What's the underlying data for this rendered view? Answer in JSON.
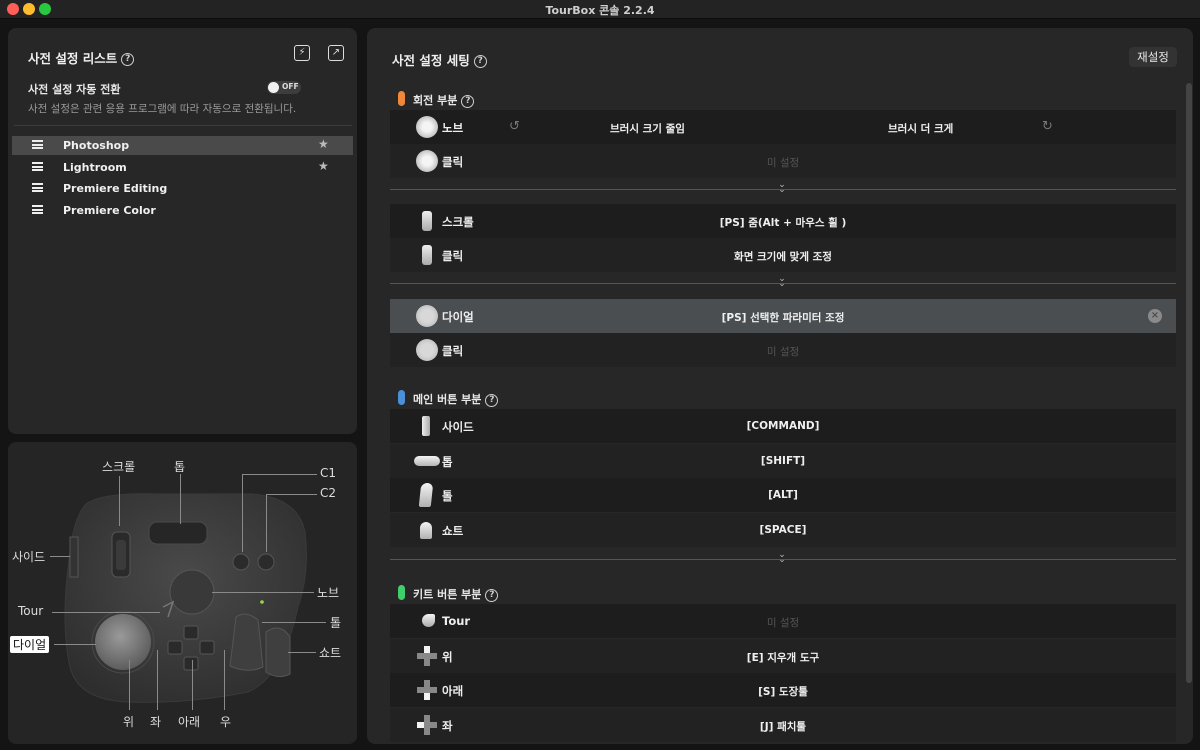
{
  "window": {
    "title": "TourBox 콘솔 2.2.4"
  },
  "left_panel": {
    "title": "사전 설정 리스트",
    "auto_switch_label": "사전 설정 자동 전환",
    "toggle_text": "OFF",
    "auto_switch_desc": "사전 설정은 관련 응용 프로그램에 따라 자동으로 전환됩니다.",
    "presets": [
      {
        "name": "Photoshop",
        "starred": true,
        "active": true
      },
      {
        "name": "Lightroom",
        "starred": true,
        "active": false
      },
      {
        "name": "Premiere Editing",
        "starred": false,
        "active": false
      },
      {
        "name": "Premiere Color",
        "starred": false,
        "active": false
      }
    ]
  },
  "device": {
    "labels": {
      "scroll": "스크롤",
      "top": "톱",
      "c1": "C1",
      "c2": "C2",
      "side": "사이드",
      "tour": "Tour",
      "knob": "노브",
      "tall": "톨",
      "dial": "다이얼",
      "short": "쇼트",
      "up": "위",
      "left": "좌",
      "down": "아래",
      "right": "우"
    }
  },
  "right_panel": {
    "title": "사전 설정 세팅",
    "reset_label": "재설정",
    "sections": {
      "rotation": {
        "title": "회전 부분",
        "color": "#f0883a"
      },
      "main": {
        "title": "메인 버튼 부분",
        "color": "#4a8fd8"
      },
      "kit": {
        "title": "키트 버튼 부분",
        "color": "#3ecf6a"
      }
    },
    "knob_row": {
      "name": "노브",
      "left_action": "브러시 크기 줄임",
      "right_action": "브러시 더 크게"
    },
    "knob_click": {
      "name": "클릭",
      "action": "미 설정"
    },
    "scroll_row": {
      "name": "스크롤",
      "action": "[PS] 줌(Alt + 마우스 휠 )"
    },
    "scroll_click": {
      "name": "클릭",
      "action": "화면 크기에 맞게 조정"
    },
    "dial_row": {
      "name": "다이얼",
      "action": "[PS] 선택한 파라미터 조정"
    },
    "dial_click": {
      "name": "클릭",
      "action": "미 설정"
    },
    "main_rows": [
      {
        "name": "사이드",
        "action": "[COMMAND]"
      },
      {
        "name": "톱",
        "action": "[SHIFT]"
      },
      {
        "name": "톨",
        "action": "[ALT]"
      },
      {
        "name": "쇼트",
        "action": "[SPACE]"
      }
    ],
    "kit_rows": [
      {
        "name": "Tour",
        "action": "미 설정"
      },
      {
        "name": "위",
        "action": "[E] 지우개 도구"
      },
      {
        "name": "아래",
        "action": "[S] 도장툴"
      },
      {
        "name": "좌",
        "action": "[J] 패치툴"
      }
    ]
  }
}
